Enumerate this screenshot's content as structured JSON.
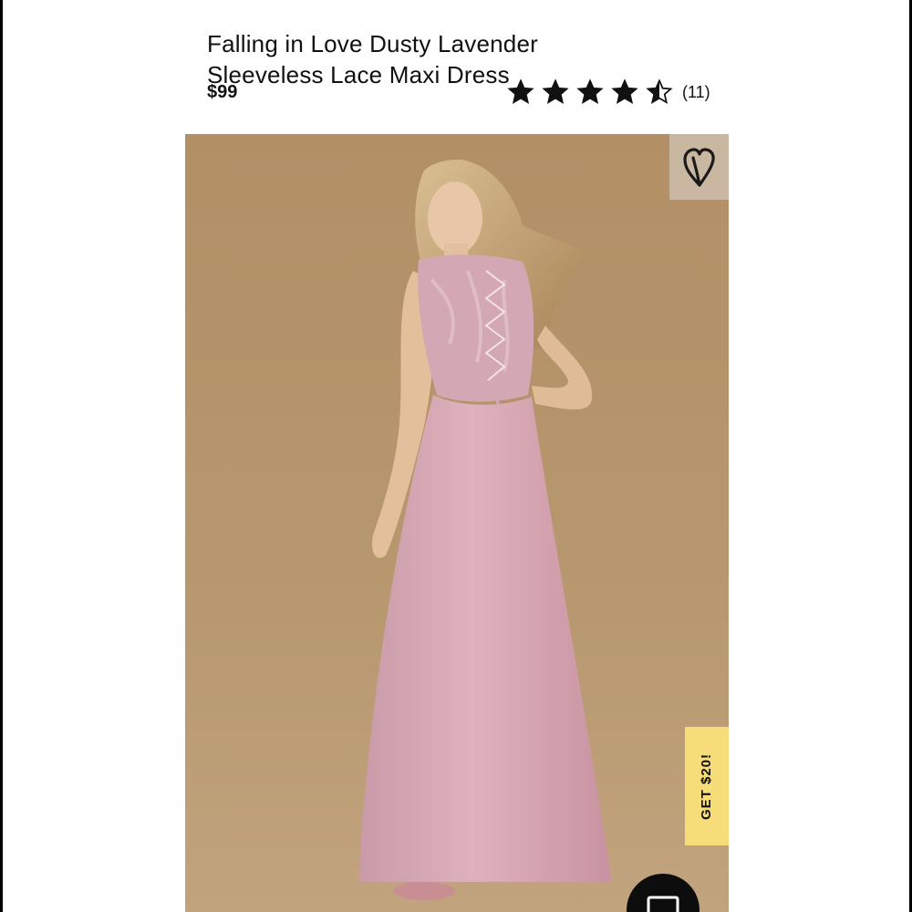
{
  "product": {
    "title_line1": "Falling in Love Dusty Lavender",
    "title_line2": "Sleeveless Lace Maxi Dress",
    "price": "$99",
    "rating": {
      "stars": 4.5,
      "max_stars": 5,
      "review_count": "(11)"
    }
  },
  "image": {
    "description_icon": "product-photo",
    "wishlist_icon": "heart-icon"
  },
  "promo": {
    "label": "GET $20!",
    "color": "#f7dd7a"
  },
  "chat": {
    "icon": "chat-icon"
  },
  "colors": {
    "photo_background": "#b4936c",
    "dress": "#d9a9b5",
    "star": "#111111"
  }
}
